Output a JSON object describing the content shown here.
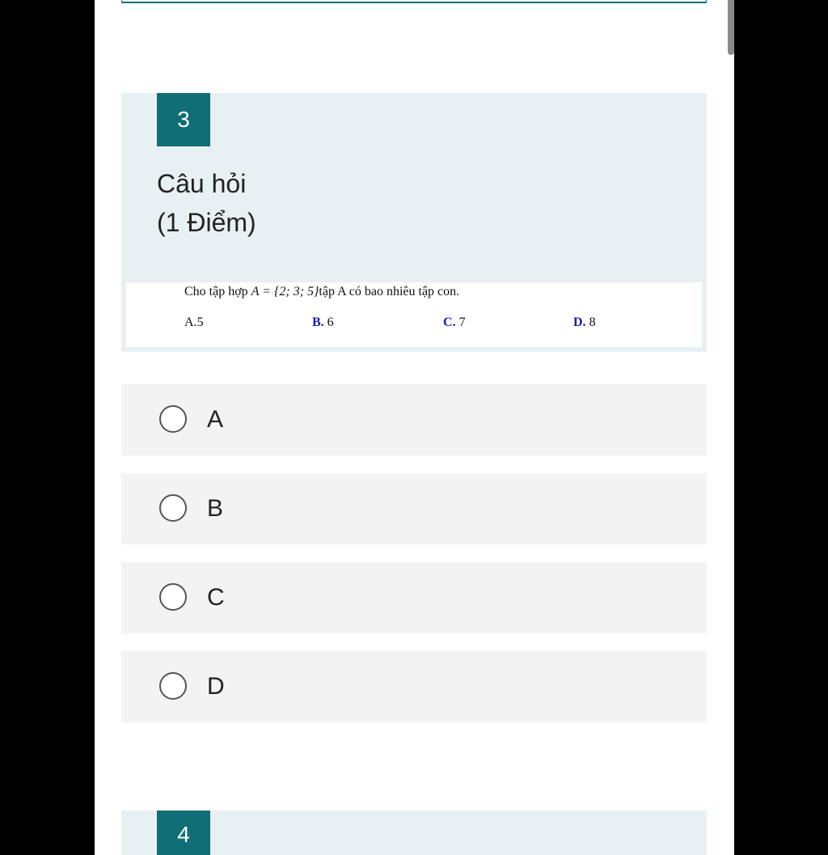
{
  "question": {
    "number": "3",
    "title": "Câu hỏi",
    "points": "(1 Điểm)",
    "text_prefix": "Cho tập hợp ",
    "math": "A = {2; 3; 5}",
    "text_suffix": "tập A có bao nhiêu tập con.",
    "image_options": [
      {
        "letter": "A.",
        "value": "5"
      },
      {
        "letter": "B.",
        "value": " 6"
      },
      {
        "letter": "C.",
        "value": " 7"
      },
      {
        "letter": "D.",
        "value": " 8"
      }
    ]
  },
  "answers": [
    {
      "label": "A"
    },
    {
      "label": "B"
    },
    {
      "label": "C"
    },
    {
      "label": "D"
    }
  ],
  "next_question": {
    "number": "4"
  },
  "colors": {
    "accent": "#0f6e76",
    "card_background": "#e7f0f3",
    "answer_background": "#f3f3f3"
  }
}
